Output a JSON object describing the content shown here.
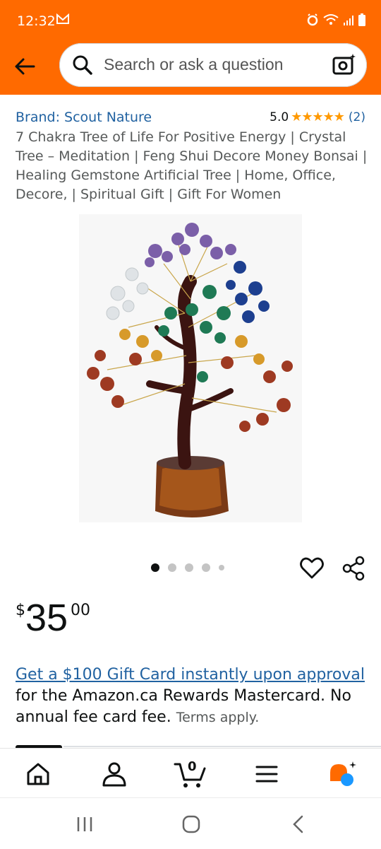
{
  "status_bar": {
    "time": "12:32",
    "notification_icon": "gmail-icon",
    "right_icons": [
      "alarm-icon",
      "wifi-icon",
      "signal-icon",
      "battery-icon"
    ]
  },
  "header": {
    "back_icon": "back-arrow-icon",
    "search_placeholder": "Search or ask a question",
    "camera_icon": "camera-search-icon"
  },
  "product": {
    "brand_label": "Brand: Scout Nature",
    "rating_value": "5.0",
    "rating_stars": 5,
    "review_count": "(2)",
    "title": "7 Chakra Tree of Life For Positive Energy | Crystal Tree – Meditation | Feng Shui Decore Money Bonsai | Healing Gemstone Artificial Tree | Home, Office, Decore, | Spiritual Gift | Gift For Women",
    "image_count": 5,
    "active_image": 1,
    "price_symbol": "$",
    "price_whole": "35",
    "price_fraction": "00"
  },
  "promo": {
    "link_text": "Get a $100 Gift Card instantly upon approval",
    "body_text": " for the Amazon.ca Rewards Mastercard. No annual fee card fee.",
    "terms_text": "Terms apply."
  },
  "bottom_nav": {
    "items": [
      "home-icon",
      "account-icon",
      "cart-icon",
      "menu-icon",
      "rufus-assistant-icon"
    ],
    "cart_count": "0"
  },
  "system_nav": [
    "recents-icon",
    "home-circle-icon",
    "back-chevron-icon"
  ],
  "colors": {
    "brand_orange": "#ff6a00",
    "link_blue": "#2162a1",
    "star_orange": "#ff9900"
  }
}
